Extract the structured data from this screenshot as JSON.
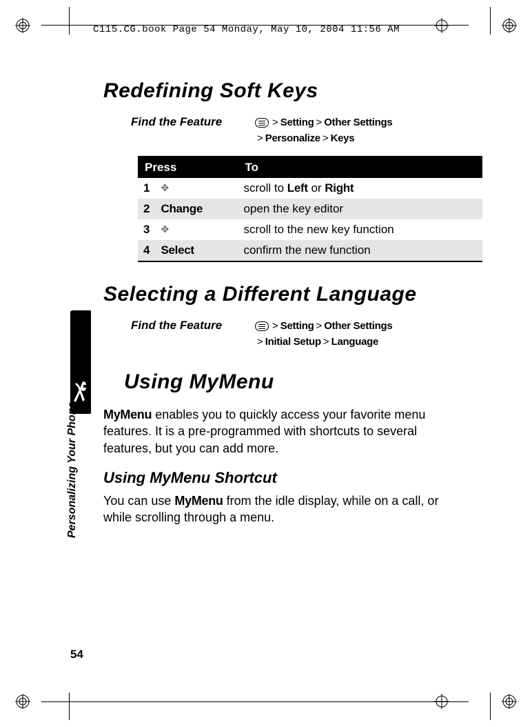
{
  "header_file_info": "C115.CG.book  Page 54  Monday, May 10, 2004  11:56 AM",
  "page_number": "54",
  "side_label": "Personalizing Your Phone",
  "section1": {
    "title": "Redefining Soft Keys",
    "find_label": "Find the Feature",
    "path_parts": [
      "Setting",
      "Other Settings",
      "Personalize",
      "Keys"
    ],
    "table": {
      "head_press": "Press",
      "head_to": "To",
      "rows": [
        {
          "num": "1",
          "press_icon": "nav",
          "press_text": "",
          "to_pre": "scroll to ",
          "to_cond1": "Left",
          "to_mid": " or ",
          "to_cond2": "Right"
        },
        {
          "num": "2",
          "press_icon": "",
          "press_text": "Change",
          "to_pre": "open the key editor",
          "to_cond1": "",
          "to_mid": "",
          "to_cond2": ""
        },
        {
          "num": "3",
          "press_icon": "nav",
          "press_text": "",
          "to_pre": "scroll to the new key function",
          "to_cond1": "",
          "to_mid": "",
          "to_cond2": ""
        },
        {
          "num": "4",
          "press_icon": "",
          "press_text": "Select",
          "to_pre": "confirm the new function",
          "to_cond1": "",
          "to_mid": "",
          "to_cond2": ""
        }
      ]
    }
  },
  "section2": {
    "title": "Selecting a Different Language",
    "find_label": "Find the Feature",
    "path_parts": [
      "Setting",
      "Other Settings",
      "Initial Setup",
      "Language"
    ]
  },
  "section3": {
    "title": "Using MyMenu",
    "para1_cond": "MyMenu",
    "para1_rest": " enables you to quickly access your favorite menu features. It is a pre-programmed with shortcuts to several features, but you can add more.",
    "sub_title": "Using MyMenu Shortcut",
    "para2_pre": "You can use ",
    "para2_cond": "MyMenu",
    "para2_post": " from the idle display, while on a call, or while scrolling through a menu."
  }
}
